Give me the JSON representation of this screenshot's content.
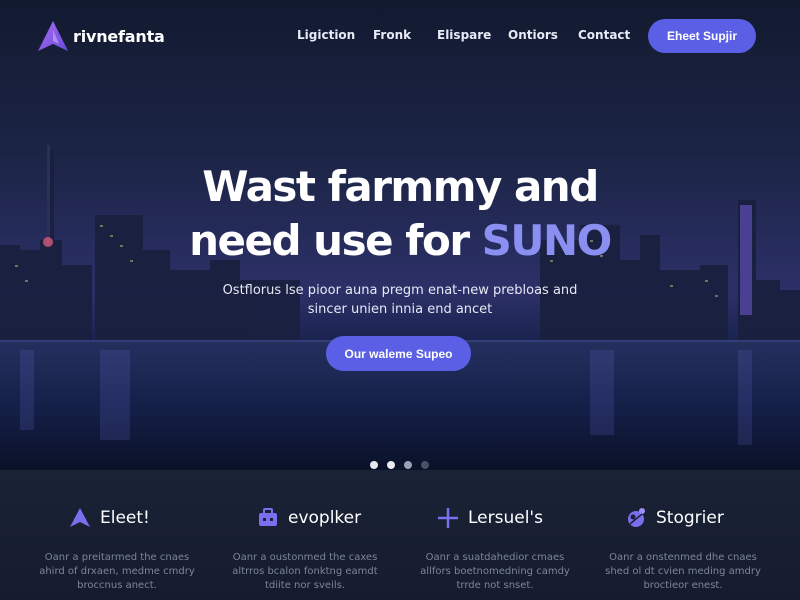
{
  "brand": {
    "name": "rivnefanta",
    "logo_icon": "triangle-logo-icon"
  },
  "nav": {
    "links": [
      "Ligiction",
      "Fronk",
      "Elispare",
      "Ontiors",
      "Contact"
    ],
    "cta_label": "Eheet Supjir"
  },
  "hero": {
    "title_line1": "Wast farmmy and",
    "title_line2_prefix": "need use for ",
    "title_line2_accent": "SUNO",
    "subtitle_line1": "Ostflorus lse pioor auna pregm enat-new prebloas and",
    "subtitle_line2": "sincer unien innia end ancet",
    "cta_label": "Our waleme Supeo",
    "carousel": {
      "count": 4,
      "active": 0
    }
  },
  "features": [
    {
      "icon": "triangle-icon",
      "title": "Eleet!",
      "desc_line1": "Oanr a preitarmed the cnaes",
      "desc_line2": "ahird of drxaen, medme cmdry",
      "desc_line3": "broccnus anect."
    },
    {
      "icon": "briefcase-icon",
      "title": "evoplker",
      "desc_line1": "Oanr a oustonmed the caxes",
      "desc_line2": "altrros bcalon fonktng eamdt",
      "desc_line3": "tdiite nor sveils."
    },
    {
      "icon": "crosshair-icon",
      "title": "Lersuel's",
      "desc_line1": "Oanr a suatdahedior cmaes",
      "desc_line2": "allfors boetnomedning camdy",
      "desc_line3": "trrde not snset."
    },
    {
      "icon": "globe-icon",
      "title": "Stogrier",
      "desc_line1": "Oanr a onstenmed dhe cnaes",
      "desc_line2": "shed ol dt cvien meding amdry",
      "desc_line3": "broctieor enest."
    }
  ],
  "colors": {
    "accent": "#5b5fe6",
    "accent_text": "#8b8ff2",
    "bg_dark": "#0f1626",
    "feature_bg": "#1a2236"
  }
}
